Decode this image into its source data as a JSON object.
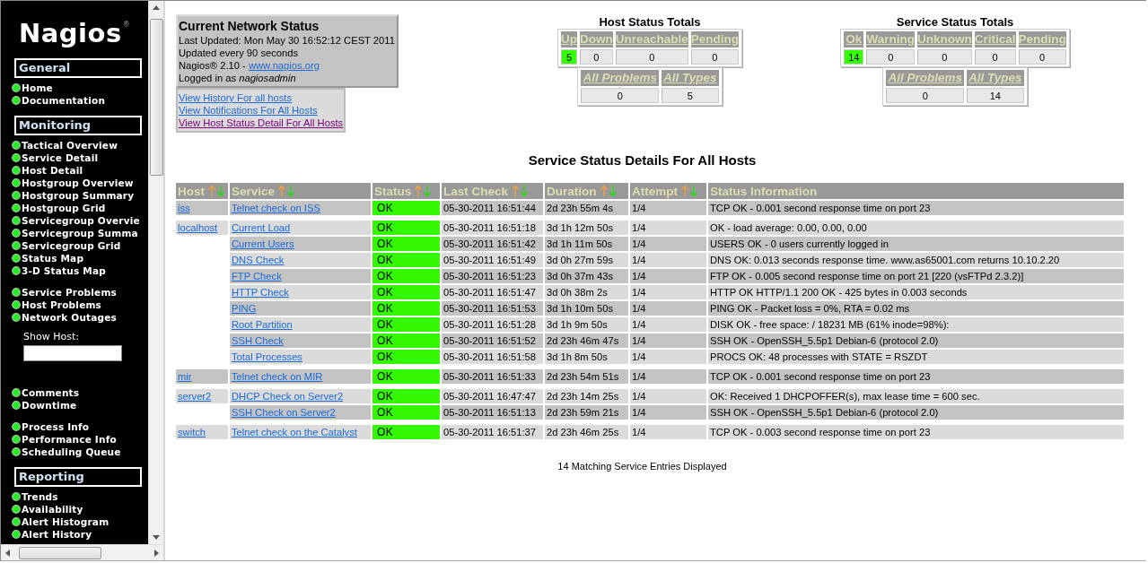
{
  "sidebar": {
    "logo": {
      "text": "Nagios",
      "mark": "®"
    },
    "blocks": [
      {
        "kind": "header",
        "title": "General"
      },
      {
        "kind": "links",
        "items": [
          "Home",
          "Documentation"
        ]
      },
      {
        "kind": "header",
        "title": "Monitoring"
      },
      {
        "kind": "links",
        "items": [
          "Tactical Overview",
          "Service Detail",
          "Host Detail",
          "Hostgroup Overview",
          "Hostgroup Summary",
          "Hostgroup Grid",
          "Servicegroup Overvie",
          "Servicegroup Summa",
          "Servicegroup Grid",
          "Status Map",
          "3-D Status Map"
        ]
      },
      {
        "kind": "links",
        "items": [
          "Service Problems",
          "Host Problems",
          "Network Outages"
        ]
      },
      {
        "kind": "search",
        "label": "Show Host:"
      },
      {
        "kind": "links",
        "items": [
          "Comments",
          "Downtime"
        ]
      },
      {
        "kind": "links",
        "items": [
          "Process Info",
          "Performance Info",
          "Scheduling Queue"
        ]
      },
      {
        "kind": "header",
        "title": "Reporting"
      },
      {
        "kind": "links",
        "items": [
          "Trends",
          "Availability",
          "Alert Histogram",
          "Alert History"
        ]
      }
    ]
  },
  "status_info": {
    "title": "Current Network Status",
    "last_updated": "Last Updated: Mon May 30 16:52:12 CEST 2011",
    "interval": "Updated every 90 seconds",
    "version": "Nagios® 2.10 - ",
    "version_link": "www.nagios.org",
    "login": "Logged in as *nagiosadmin*"
  },
  "view_links": [
    {
      "text": "View History For all hosts",
      "visited": false
    },
    {
      "text": "View Notifications For All Hosts",
      "visited": false
    },
    {
      "text": "View Host Status Detail For All Hosts",
      "visited": true
    }
  ],
  "host_totals": {
    "title": "Host Status Totals",
    "columns": [
      {
        "label": "Up",
        "count": "5",
        "highlighted": true
      },
      {
        "label": "Down",
        "count": "0",
        "highlighted": false
      },
      {
        "label": "Unreachable",
        "count": "0",
        "highlighted": false
      },
      {
        "label": "Pending",
        "count": "0",
        "highlighted": false
      }
    ],
    "summary": [
      {
        "label": "All Problems",
        "count": "0"
      },
      {
        "label": "All Types",
        "count": "5"
      }
    ]
  },
  "service_totals": {
    "title": "Service Status Totals",
    "columns": [
      {
        "label": "Ok",
        "count": "14",
        "highlighted": true
      },
      {
        "label": "Warning",
        "count": "0",
        "highlighted": false
      },
      {
        "label": "Unknown",
        "count": "0",
        "highlighted": false
      },
      {
        "label": "Critical",
        "count": "0",
        "highlighted": false
      },
      {
        "label": "Pending",
        "count": "0",
        "highlighted": false
      }
    ],
    "summary": [
      {
        "label": "All Problems",
        "count": "0"
      },
      {
        "label": "All Types",
        "count": "14"
      }
    ]
  },
  "details": {
    "title": "Service Status Details For All Hosts",
    "columns": [
      {
        "label": "Host",
        "sortable": true
      },
      {
        "label": "Service",
        "sortable": true
      },
      {
        "label": "Status",
        "sortable": true
      },
      {
        "label": "Last Check",
        "sortable": true
      },
      {
        "label": "Duration",
        "sortable": true
      },
      {
        "label": "Attempt",
        "sortable": true
      },
      {
        "label": "Status Information",
        "sortable": false
      }
    ],
    "groups": [
      {
        "host": "iss",
        "rows": [
          {
            "service": "Telnet check on ISS",
            "status": "OK",
            "last_check": "05-30-2011 16:51:44",
            "duration": "2d 23h 55m 4s",
            "attempt": "1/4",
            "info": "TCP OK - 0.001 second response time on port 23"
          }
        ]
      },
      {
        "host": "localhost",
        "rows": [
          {
            "service": "Current Load",
            "status": "OK",
            "last_check": "05-30-2011 16:51:18",
            "duration": "3d 1h 12m 50s",
            "attempt": "1/4",
            "info": "OK - load average: 0.00, 0.00, 0.00"
          },
          {
            "service": "Current Users",
            "status": "OK",
            "last_check": "05-30-2011 16:51:42",
            "duration": "3d 1h 11m 50s",
            "attempt": "1/4",
            "info": "USERS OK - 0 users currently logged in"
          },
          {
            "service": "DNS Check",
            "status": "OK",
            "last_check": "05-30-2011 16:51:49",
            "duration": "3d 0h 27m 59s",
            "attempt": "1/4",
            "info": "DNS OK: 0.013 seconds response time. www.as65001.com returns 10.10.2.20"
          },
          {
            "service": "FTP Check",
            "status": "OK",
            "last_check": "05-30-2011 16:51:23",
            "duration": "3d 0h 37m 43s",
            "attempt": "1/4",
            "info": "FTP OK - 0.005 second response time on port 21 [220 (vsFTPd 2.3.2)]"
          },
          {
            "service": "HTTP Check",
            "status": "OK",
            "last_check": "05-30-2011 16:51:47",
            "duration": "3d 0h 38m 2s",
            "attempt": "1/4",
            "info": "HTTP OK HTTP/1.1 200 OK - 425 bytes in 0.003 seconds"
          },
          {
            "service": "PING",
            "status": "OK",
            "last_check": "05-30-2011 16:51:53",
            "duration": "3d 1h 10m 50s",
            "attempt": "1/4",
            "info": "PING OK - Packet loss = 0%, RTA = 0.02 ms"
          },
          {
            "service": "Root Partition",
            "status": "OK",
            "last_check": "05-30-2011 16:51:28",
            "duration": "3d 1h 9m 50s",
            "attempt": "1/4",
            "info": "DISK OK - free space: / 18231 MB (61% inode=98%):"
          },
          {
            "service": "SSH Check",
            "status": "OK",
            "last_check": "05-30-2011 16:51:52",
            "duration": "2d 23h 46m 47s",
            "attempt": "1/4",
            "info": "SSH OK - OpenSSH_5.5p1 Debian-6 (protocol 2.0)"
          },
          {
            "service": "Total Processes",
            "status": "OK",
            "last_check": "05-30-2011 16:51:58",
            "duration": "3d 1h 8m 50s",
            "attempt": "1/4",
            "info": "PROCS OK: 48 processes with STATE = RSZDT"
          }
        ]
      },
      {
        "host": "mir",
        "rows": [
          {
            "service": "Telnet check on MIR",
            "status": "OK",
            "last_check": "05-30-2011 16:51:33",
            "duration": "2d 23h 54m 51s",
            "attempt": "1/4",
            "info": "TCP OK - 0.001 second response time on port 23"
          }
        ]
      },
      {
        "host": "server2",
        "rows": [
          {
            "service": "DHCP Check on Server2",
            "status": "OK",
            "last_check": "05-30-2011 16:47:47",
            "duration": "2d 23h 14m 25s",
            "attempt": "1/4",
            "info": "OK: Received 1 DHCPOFFER(s), max lease time = 600 sec."
          },
          {
            "service": "SSH Check on Server2",
            "status": "OK",
            "last_check": "05-30-2011 16:51:13",
            "duration": "2d 23h 59m 21s",
            "attempt": "1/4",
            "info": "SSH OK - OpenSSH_5.5p1 Debian-6 (protocol 2.0)"
          }
        ]
      },
      {
        "host": "switch",
        "rows": [
          {
            "service": "Telnet check on the Catalyst",
            "status": "OK",
            "last_check": "05-30-2011 16:51:37",
            "duration": "2d 23h 46m 25s",
            "attempt": "1/4",
            "info": "TCP OK - 0.003 second response time on port 23"
          }
        ]
      }
    ],
    "footer": "14 Matching Service Entries Displayed"
  }
}
